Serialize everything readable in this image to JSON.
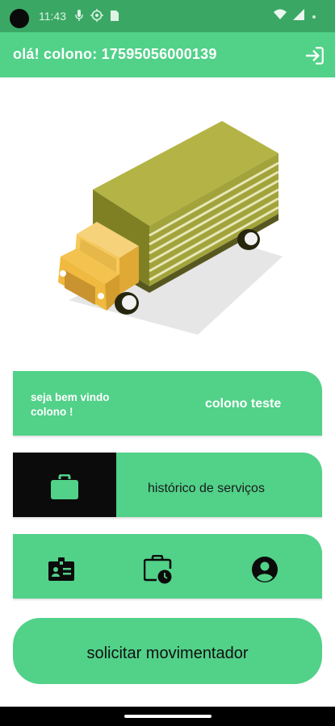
{
  "status_bar": {
    "time": "11:43",
    "icons": [
      "mic-icon",
      "location-icon",
      "sim-icon",
      "wifi-icon",
      "signal-icon",
      "battery-dot-icon"
    ]
  },
  "app_bar": {
    "title": "olá! colono: 17595056000139",
    "logout_icon": "logout-icon"
  },
  "welcome_card": {
    "greeting_line1": "seja bem vindo",
    "greeting_line2": "colono !",
    "user_name": "colono teste"
  },
  "history_card": {
    "icon": "briefcase-icon",
    "label": "histórico de serviços"
  },
  "actions_card": {
    "icons": [
      "id-badge-icon",
      "briefcase-clock-icon",
      "account-circle-icon"
    ]
  },
  "request_button": {
    "label": "solicitar movimentador"
  },
  "colors": {
    "status_bar": "#3aa864",
    "primary": "#52d189",
    "dark": "#0b0b0b",
    "truck_cargo": "#a2a33b",
    "truck_cab": "#f4c24e"
  }
}
